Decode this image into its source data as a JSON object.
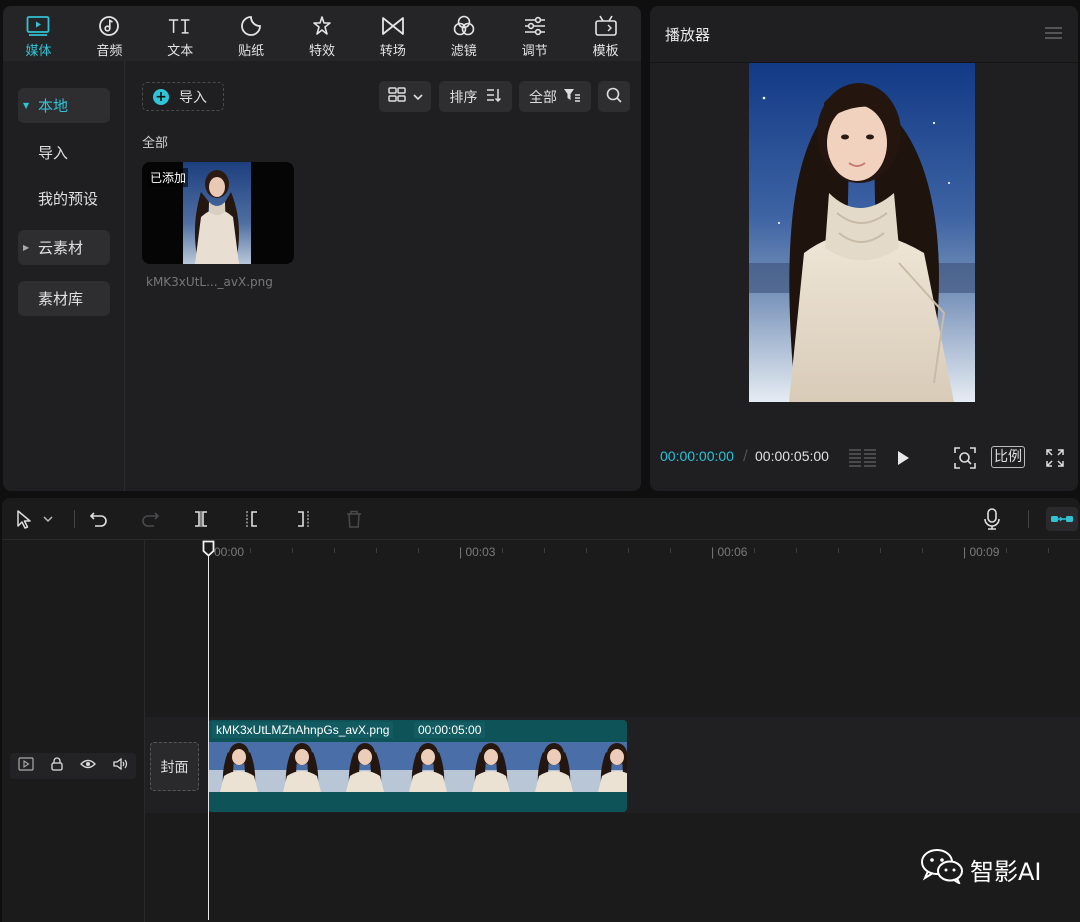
{
  "tabs": [
    {
      "label": "媒体",
      "icon": "media-play-icon",
      "active": true
    },
    {
      "label": "音频",
      "icon": "music-note-icon"
    },
    {
      "label": "文本",
      "icon": "text-ti-icon"
    },
    {
      "label": "贴纸",
      "icon": "sticker-icon"
    },
    {
      "label": "特效",
      "icon": "sparkle-star-icon"
    },
    {
      "label": "转场",
      "icon": "bowtie-transition-icon"
    },
    {
      "label": "滤镜",
      "icon": "filter-circles-icon"
    },
    {
      "label": "调节",
      "icon": "sliders-icon"
    },
    {
      "label": "模板",
      "icon": "template-icon"
    }
  ],
  "sidebar": {
    "local": "本地",
    "import": "导入",
    "presets": "我的预设",
    "cloud": "云素材",
    "library": "素材库"
  },
  "media": {
    "import_label": "导入",
    "sort_label": "排序",
    "filter_label": "全部",
    "all_label": "全部",
    "added_badge": "已添加",
    "file_name": "kMK3xUtL..._avX.png"
  },
  "player": {
    "title": "播放器",
    "current_time": "00:00:00:00",
    "separator": "/",
    "total_time": "00:00:05:00",
    "ratio_label": "比例"
  },
  "timeline": {
    "ticks": [
      "00:00",
      "| 00:03",
      "| 00:06",
      "| 00:09"
    ],
    "cover_label": "封面",
    "clip_name": "kMK3xUtLMZhAhnpGs_avX.png",
    "clip_duration": "00:00:05:00"
  },
  "watermark": {
    "text": "智影AI"
  },
  "colors": {
    "accent": "#33c2d4",
    "clip": "#0e5358"
  }
}
